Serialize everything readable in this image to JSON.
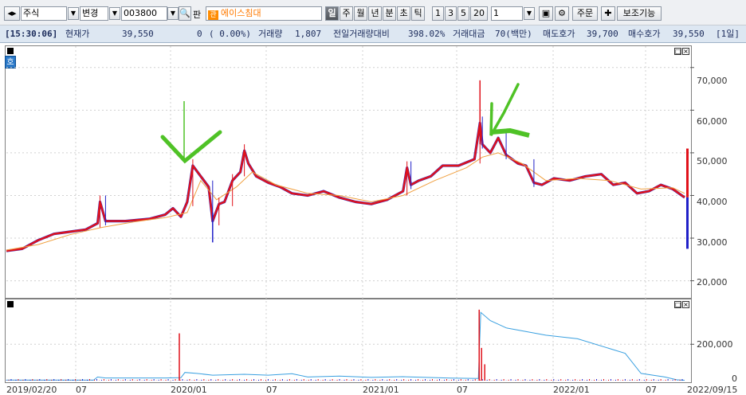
{
  "toolbar": {
    "market": "주식",
    "change_label": "변경",
    "code": "003800",
    "pan_label": "판",
    "badge": "관",
    "stock_name": "에이스침대",
    "periods": [
      "일",
      "주",
      "월",
      "년",
      "분",
      "초",
      "틱"
    ],
    "active_period": "일",
    "multipliers": [
      "1",
      "3",
      "5",
      "20"
    ],
    "count": "1",
    "order_label": "주문",
    "aux_label": "보조기능"
  },
  "info": {
    "time": "[15:30:06]",
    "price_label": "현재가",
    "price": "39,550",
    "change": "0",
    "change_pct": "( 0.00%)",
    "volume_label": "거래량",
    "volume": "1,807",
    "vol_ratio_label": "전일거래량대비",
    "vol_ratio": "398.02%",
    "amount_label": "거래대금",
    "amount": "70(백만)",
    "ask_label": "매도호가",
    "ask": "39,700",
    "bid_label": "매수호가",
    "bid": "39,550",
    "unit": "[1일]"
  },
  "ho_label": "호",
  "chart_data": {
    "type": "line",
    "price_axis": {
      "ticks": [
        "70,000",
        "60,000",
        "50,000",
        "40,000",
        "30,000",
        "20,000"
      ],
      "ylim": [
        16000,
        75000
      ]
    },
    "volume_axis": {
      "ticks": [
        "200,000",
        "0"
      ]
    },
    "x_labels": [
      "2019/02/20",
      "07",
      "2020/01",
      "07",
      "2021/01",
      "07",
      "2022/01",
      "07",
      "2022/09/15"
    ],
    "price_series": [
      [
        0,
        27000
      ],
      [
        20,
        27500
      ],
      [
        40,
        29500
      ],
      [
        60,
        31000
      ],
      [
        80,
        31500
      ],
      [
        100,
        32000
      ],
      [
        115,
        33500
      ],
      [
        118,
        38500
      ],
      [
        125,
        34000
      ],
      [
        150,
        34000
      ],
      [
        180,
        34500
      ],
      [
        200,
        35500
      ],
      [
        210,
        37000
      ],
      [
        220,
        35000
      ],
      [
        228,
        38500
      ],
      [
        235,
        47000
      ],
      [
        245,
        44500
      ],
      [
        255,
        42000
      ],
      [
        260,
        34000
      ],
      [
        268,
        38000
      ],
      [
        275,
        38500
      ],
      [
        285,
        43500
      ],
      [
        295,
        45500
      ],
      [
        300,
        50500
      ],
      [
        305,
        47500
      ],
      [
        315,
        44500
      ],
      [
        330,
        43000
      ],
      [
        345,
        42000
      ],
      [
        360,
        40500
      ],
      [
        380,
        40000
      ],
      [
        400,
        41000
      ],
      [
        420,
        39500
      ],
      [
        440,
        38500
      ],
      [
        460,
        38000
      ],
      [
        480,
        39000
      ],
      [
        500,
        41000
      ],
      [
        505,
        46500
      ],
      [
        510,
        42500
      ],
      [
        520,
        43500
      ],
      [
        535,
        44500
      ],
      [
        550,
        47000
      ],
      [
        570,
        47000
      ],
      [
        590,
        48500
      ],
      [
        597,
        57000
      ],
      [
        600,
        52000
      ],
      [
        610,
        50000
      ],
      [
        620,
        53500
      ],
      [
        630,
        49500
      ],
      [
        645,
        47500
      ],
      [
        655,
        47000
      ],
      [
        665,
        43000
      ],
      [
        675,
        42500
      ],
      [
        690,
        44000
      ],
      [
        710,
        43500
      ],
      [
        730,
        44500
      ],
      [
        750,
        45000
      ],
      [
        765,
        42500
      ],
      [
        780,
        43000
      ],
      [
        795,
        40500
      ],
      [
        810,
        41000
      ],
      [
        825,
        42500
      ],
      [
        840,
        41500
      ],
      [
        855,
        39550
      ]
    ],
    "ma_series": [
      [
        0,
        27200
      ],
      [
        40,
        28500
      ],
      [
        80,
        30800
      ],
      [
        120,
        32500
      ],
      [
        160,
        33800
      ],
      [
        200,
        34800
      ],
      [
        228,
        36000
      ],
      [
        245,
        43500
      ],
      [
        265,
        39000
      ],
      [
        290,
        42000
      ],
      [
        310,
        45500
      ],
      [
        340,
        42500
      ],
      [
        380,
        40500
      ],
      [
        420,
        40000
      ],
      [
        460,
        38500
      ],
      [
        500,
        40000
      ],
      [
        540,
        43500
      ],
      [
        580,
        46500
      ],
      [
        600,
        49000
      ],
      [
        620,
        50000
      ],
      [
        650,
        47500
      ],
      [
        680,
        43500
      ],
      [
        720,
        44000
      ],
      [
        760,
        43500
      ],
      [
        800,
        41500
      ],
      [
        840,
        41800
      ],
      [
        855,
        40500
      ]
    ],
    "volume_series": [
      [
        0,
        3000
      ],
      [
        110,
        3000
      ],
      [
        115,
        20000
      ],
      [
        125,
        15000
      ],
      [
        200,
        15000
      ],
      [
        220,
        16000
      ],
      [
        225,
        45000
      ],
      [
        240,
        40000
      ],
      [
        260,
        30000
      ],
      [
        300,
        35000
      ],
      [
        330,
        30000
      ],
      [
        360,
        38000
      ],
      [
        380,
        20000
      ],
      [
        420,
        25000
      ],
      [
        460,
        18000
      ],
      [
        500,
        22000
      ],
      [
        560,
        14000
      ],
      [
        595,
        12000
      ],
      [
        598,
        375000
      ],
      [
        610,
        330000
      ],
      [
        630,
        290000
      ],
      [
        680,
        250000
      ],
      [
        720,
        230000
      ],
      [
        780,
        150000
      ],
      [
        800,
        40000
      ],
      [
        830,
        20000
      ],
      [
        845,
        5000
      ],
      [
        855,
        2000
      ]
    ],
    "volume_spikes": [
      [
        218,
        260000
      ],
      [
        596,
        390000
      ],
      [
        599,
        180000
      ],
      [
        603,
        90000
      ]
    ]
  }
}
